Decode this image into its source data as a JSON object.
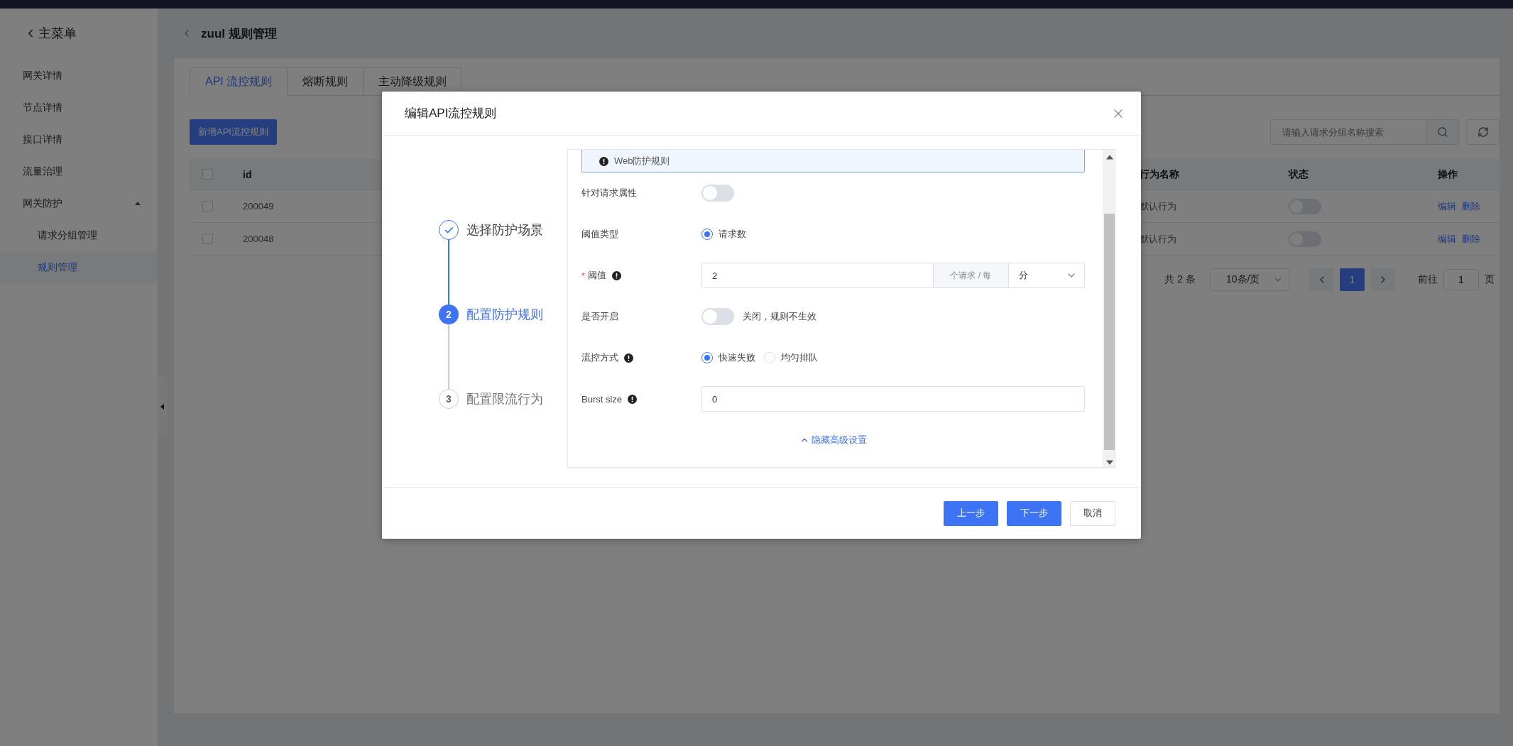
{
  "sidebar": {
    "back_label": "主菜单",
    "items": [
      {
        "kind": "link",
        "label": "网关详情",
        "selected": false
      },
      {
        "kind": "link",
        "label": "节点详情",
        "selected": false
      },
      {
        "kind": "link",
        "label": "接口详情",
        "selected": false
      },
      {
        "kind": "link",
        "label": "流量治理",
        "selected": false
      },
      {
        "kind": "group",
        "label": "网关防护",
        "selected": false,
        "expanded": true,
        "children": [
          {
            "label": "请求分组管理",
            "selected": false
          },
          {
            "label": "规则管理",
            "selected": true
          }
        ]
      }
    ]
  },
  "header": {
    "title": "zuul 规则管理"
  },
  "tabs": [
    {
      "label": "API 流控规则",
      "selected": true
    },
    {
      "label": "熔断规则",
      "selected": false
    },
    {
      "label": "主动降级规则",
      "selected": false
    }
  ],
  "add_button": "新增API流控规则",
  "search": {
    "placeholder": "请输入请求分组名称搜索"
  },
  "table": {
    "all_checked": false,
    "columns": [
      "id",
      "行为名称",
      "状态",
      "操作"
    ],
    "rows": [
      {
        "checked": false,
        "id": "200049",
        "behavior": "默认行为",
        "on": false,
        "actions": [
          "编辑",
          "删除"
        ]
      },
      {
        "checked": false,
        "id": "200048",
        "behavior": "默认行为",
        "on": false,
        "actions": [
          "编辑",
          "删除"
        ]
      }
    ]
  },
  "pagination": {
    "total": "共 2 条",
    "page_size": "10条/页",
    "pages": [
      {
        "label": "1",
        "selected": true
      }
    ],
    "goto_label": "前往",
    "goto_value": "1",
    "goto_suffix": "页"
  },
  "dialog": {
    "title": "编辑API流控规则",
    "steps": [
      {
        "label": "选择防护场景",
        "completed": true,
        "current": false
      },
      {
        "number": "2",
        "label": "配置防护规则",
        "completed": false,
        "current": true
      },
      {
        "number": "3",
        "label": "配置限流行为",
        "completed": false,
        "current": false
      }
    ],
    "form": {
      "notice": "Web防护规则",
      "rows": [
        {
          "kind": "switch",
          "label": "针对请求属性",
          "on": false
        },
        {
          "kind": "radio",
          "label": "阈值类型",
          "options": [
            {
              "label": "请求数",
              "selected": true
            }
          ]
        },
        {
          "kind": "threshold",
          "required_mark": "*",
          "label": "阈值",
          "info": true,
          "value": "2",
          "addon": "个请求 / 每",
          "unit": "分"
        },
        {
          "kind": "switch",
          "label": "是否开启",
          "on": false,
          "note": "关闭，规则不生效"
        },
        {
          "kind": "radio",
          "label": "流控方式",
          "info": true,
          "options": [
            {
              "label": "快速失败",
              "selected": true
            },
            {
              "label": "均匀排队",
              "selected": false
            }
          ]
        },
        {
          "kind": "input",
          "label": "Burst size",
          "info": true,
          "value": "0"
        }
      ],
      "toggle_link": "隐藏高级设置"
    },
    "buttons": [
      {
        "label": "上一步",
        "kind": "primary"
      },
      {
        "label": "下一步",
        "kind": "primary"
      },
      {
        "label": "取消",
        "kind": "default"
      }
    ]
  }
}
